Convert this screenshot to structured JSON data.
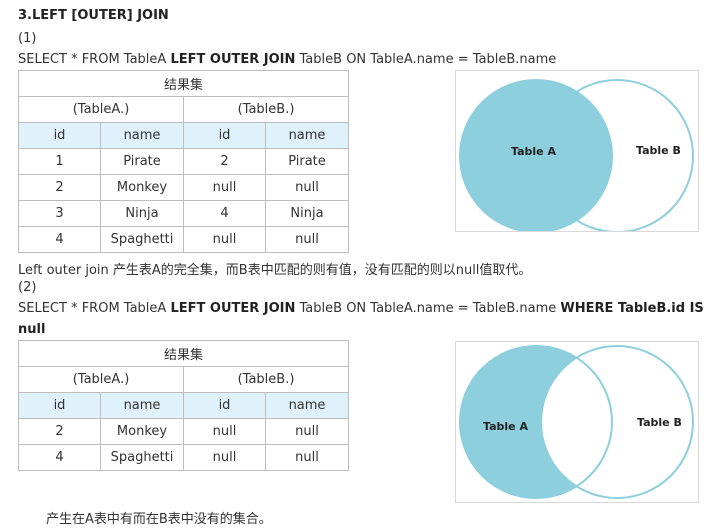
{
  "section_title": "3.LEFT [OUTER] JOIN",
  "part1": {
    "label": "(1)",
    "sql": {
      "a": "SELECT * FROM TableA ",
      "b": "LEFT OUTER JOIN",
      "c": " TableB ON TableA.name = TableB.name"
    },
    "table": {
      "caption": "结果集",
      "groups": [
        "(TableA.)",
        "(TableB.)"
      ],
      "headers": [
        "id",
        "name",
        "id",
        "name"
      ],
      "rows": [
        [
          "1",
          "Pirate",
          "2",
          "Pirate"
        ],
        [
          "2",
          "Monkey",
          "null",
          "null"
        ],
        [
          "3",
          "Ninja",
          "4",
          "Ninja"
        ],
        [
          "4",
          "Spaghetti",
          "null",
          "null"
        ]
      ]
    },
    "venn": {
      "a_label": "Table A",
      "b_label": "Table B"
    },
    "description": "Left outer join 产生表A的完全集，而B表中匹配的则有值，没有匹配的则以null值取代。"
  },
  "part2": {
    "label": "(2)",
    "sql": {
      "a": "SELECT * FROM TableA ",
      "b": "LEFT OUTER JOIN",
      "c": " TableB ON TableA.name = TableB.name ",
      "d": "WHERE TableB.id IS",
      "e": "null"
    },
    "table": {
      "caption": "结果集",
      "groups": [
        "(TableA.)",
        "(TableB.)"
      ],
      "headers": [
        "id",
        "name",
        "id",
        "name"
      ],
      "rows": [
        [
          "2",
          "Monkey",
          "null",
          "null"
        ],
        [
          "4",
          "Spaghetti",
          "null",
          "null"
        ]
      ]
    },
    "venn": {
      "a_label": "Table A",
      "b_label": "Table B"
    },
    "description": "产生在A表中有而在B表中没有的集合。"
  },
  "colors": {
    "fill": "#8ecfde",
    "stroke": "#8ecfde",
    "header_bg": "#dff2fb"
  }
}
